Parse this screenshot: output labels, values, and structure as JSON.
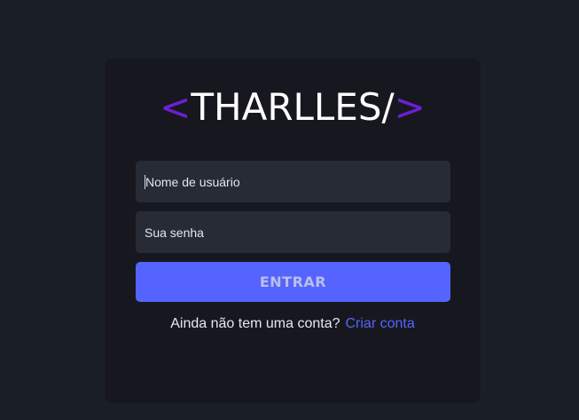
{
  "logo": {
    "open_bracket": "<",
    "name": "THARLLES/",
    "close_bracket": ">"
  },
  "form": {
    "username_placeholder": "Nome de usuário",
    "password_placeholder": "Sua senha",
    "submit_label": "ENTRAR"
  },
  "signup": {
    "question": "Ainda não tem uma conta?",
    "link_label": "Criar conta"
  },
  "colors": {
    "background": "#1a1f27",
    "card": "#17181f",
    "input": "#262b36",
    "accent": "#5564fe",
    "bracket": "#6d1fd6"
  }
}
